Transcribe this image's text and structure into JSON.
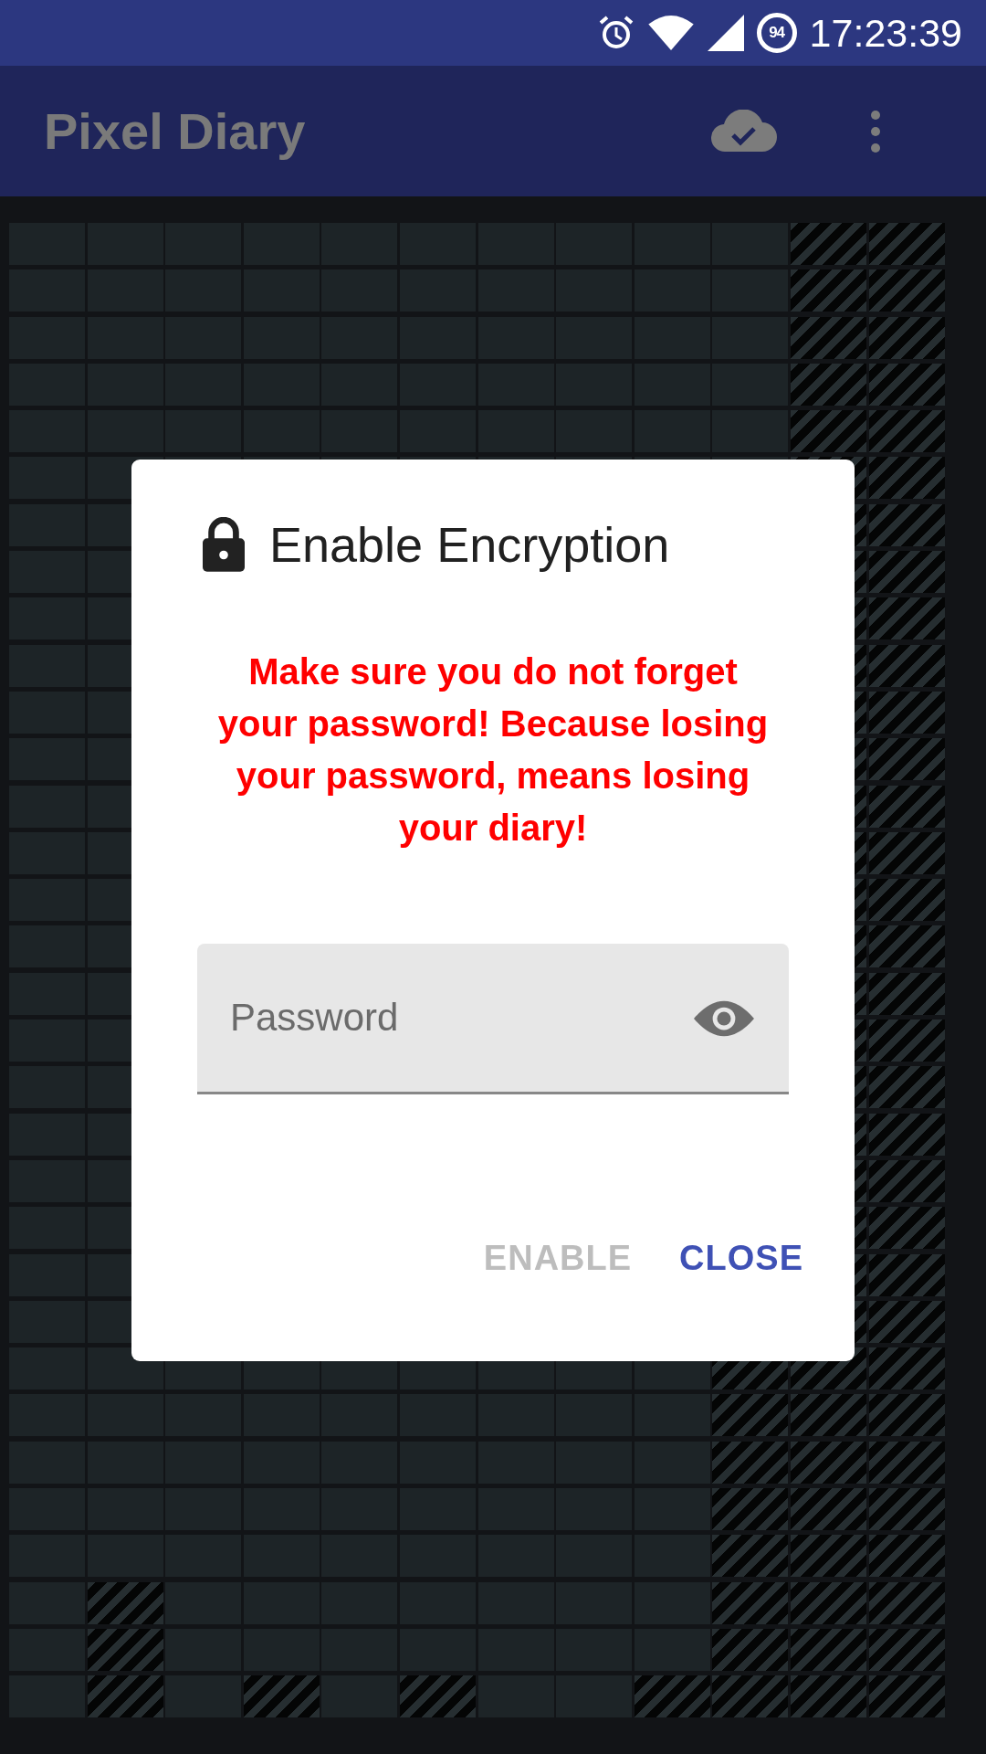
{
  "status_bar": {
    "battery_percent": "94",
    "time": "17:23:39"
  },
  "app_bar": {
    "title": "Pixel Diary"
  },
  "grid": {
    "rows": [
      {
        "hatched": [
          false,
          false,
          false,
          false,
          false,
          false,
          false,
          false,
          false,
          false,
          true,
          true
        ]
      },
      {
        "hatched": [
          false,
          false,
          false,
          false,
          false,
          false,
          false,
          false,
          false,
          false,
          true,
          true
        ]
      },
      {
        "hatched": [
          false,
          false,
          false,
          false,
          false,
          false,
          false,
          false,
          false,
          false,
          true,
          true
        ]
      },
      {
        "hatched": [
          false,
          false,
          false,
          false,
          false,
          false,
          false,
          false,
          false,
          false,
          true,
          true
        ]
      },
      {
        "hatched": [
          false,
          false,
          false,
          false,
          false,
          false,
          false,
          false,
          false,
          false,
          true,
          true
        ]
      },
      {
        "hatched_left": [
          false,
          false
        ],
        "hatched_right": [
          true,
          true
        ]
      },
      {
        "hatched_left": [
          false,
          false
        ],
        "hatched_right": [
          true,
          true
        ]
      },
      {
        "hatched_left": [
          false,
          false
        ],
        "hatched_right": [
          true,
          true
        ]
      },
      {
        "hatched_left": [
          false,
          false
        ],
        "hatched_right": [
          true,
          true
        ]
      },
      {
        "hatched_left": [
          false,
          false
        ],
        "hatched_right": [
          true,
          true
        ]
      },
      {
        "hatched_left": [
          false,
          false
        ],
        "hatched_right": [
          true,
          true
        ]
      },
      {
        "hatched_left": [
          false,
          false
        ],
        "hatched_right": [
          true,
          true
        ]
      },
      {
        "hatched_left": [
          false,
          false
        ],
        "hatched_right": [
          true,
          true
        ]
      },
      {
        "hatched_left": [
          false,
          false
        ],
        "hatched_right": [
          true,
          true
        ]
      },
      {
        "hatched_left": [
          false,
          false
        ],
        "hatched_right": [
          true,
          true
        ]
      },
      {
        "hatched_left": [
          false,
          false
        ],
        "hatched_right": [
          true,
          true
        ]
      },
      {
        "hatched_left": [
          false,
          false
        ],
        "hatched_right": [
          true,
          true
        ]
      },
      {
        "hatched_left": [
          false,
          false
        ],
        "hatched_right": [
          true,
          true
        ]
      },
      {
        "hatched_left": [
          false,
          false
        ],
        "hatched_right": [
          true,
          true
        ]
      },
      {
        "hatched_left": [
          false,
          false
        ],
        "hatched_right": [
          true,
          true
        ]
      },
      {
        "hatched_left": [
          false,
          false
        ],
        "hatched_right": [
          true,
          true
        ]
      },
      {
        "hatched_left": [
          false,
          false
        ],
        "hatched_right": [
          true,
          true
        ]
      },
      {
        "hatched_left": [
          false,
          false
        ],
        "hatched_right": [
          true,
          true
        ]
      },
      {
        "hatched_left": [
          false,
          false
        ],
        "hatched_right": [
          true,
          true
        ]
      },
      {
        "hatched": [
          false,
          false,
          false,
          false,
          false,
          false,
          false,
          false,
          false,
          true,
          true,
          true
        ]
      },
      {
        "hatched": [
          false,
          false,
          false,
          false,
          false,
          false,
          false,
          false,
          false,
          true,
          true,
          true
        ]
      },
      {
        "hatched": [
          false,
          false,
          false,
          false,
          false,
          false,
          false,
          false,
          false,
          true,
          true,
          true
        ]
      },
      {
        "hatched": [
          false,
          false,
          false,
          false,
          false,
          false,
          false,
          false,
          false,
          true,
          true,
          true
        ]
      },
      {
        "hatched": [
          false,
          false,
          false,
          false,
          false,
          false,
          false,
          false,
          false,
          true,
          true,
          true
        ]
      },
      {
        "hatched": [
          false,
          true,
          false,
          false,
          false,
          false,
          false,
          false,
          false,
          true,
          true,
          true
        ]
      },
      {
        "hatched": [
          false,
          true,
          false,
          false,
          false,
          false,
          false,
          false,
          false,
          true,
          true,
          true
        ]
      },
      {
        "hatched": [
          false,
          true,
          false,
          true,
          false,
          true,
          false,
          false,
          true,
          true,
          true,
          true
        ]
      }
    ]
  },
  "dialog": {
    "title": "Enable Encryption",
    "warning": "Make sure you do not forget your password! Because losing your password, means losing your diary!",
    "password_field": {
      "placeholder": "Password"
    },
    "buttons": [
      {
        "label": "ENABLE",
        "disabled": true
      },
      {
        "label": "CLOSE",
        "disabled": false
      }
    ]
  }
}
